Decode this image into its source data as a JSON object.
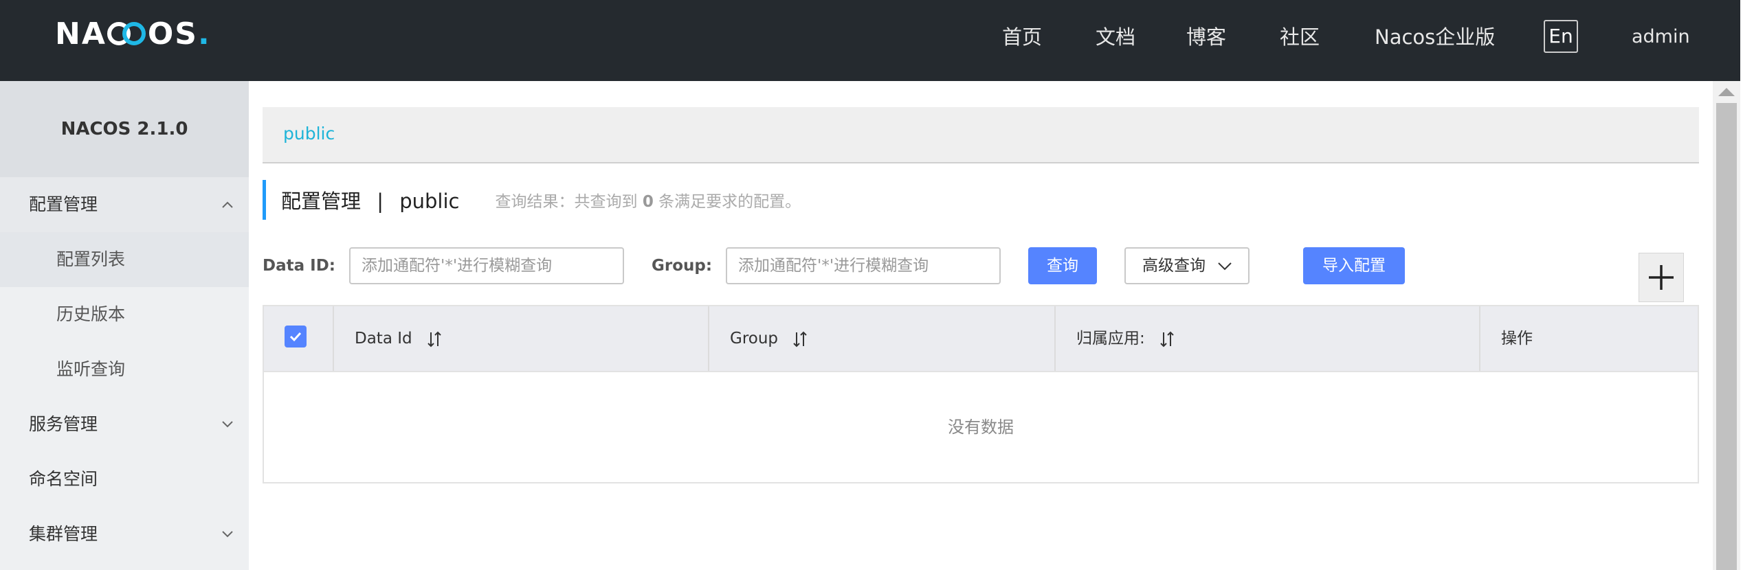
{
  "header": {
    "logo": {
      "prefix": "NA",
      "suffix": "OS",
      "dot": "."
    },
    "nav": [
      "首页",
      "文档",
      "博客",
      "社区",
      "Nacos企业版"
    ],
    "lang": "En",
    "user": "admin"
  },
  "sidebar": {
    "title": "NACOS 2.1.0",
    "items": [
      {
        "label": "配置管理",
        "expanded": true
      },
      {
        "label": "配置列表",
        "sub": true,
        "active": true
      },
      {
        "label": "历史版本",
        "sub": true
      },
      {
        "label": "监听查询",
        "sub": true
      },
      {
        "label": "服务管理",
        "expanded": false
      },
      {
        "label": "命名空间"
      },
      {
        "label": "集群管理",
        "expanded": false
      }
    ]
  },
  "main": {
    "namespace": "public",
    "title": "配置管理",
    "title_sep": "|",
    "title_ns": "public",
    "result": {
      "prefix": "查询结果：共查询到",
      "count": "0",
      "suffix": "条满足要求的配置。"
    },
    "filters": {
      "dataid_label": "Data ID:",
      "dataid_placeholder": "添加通配符'*'进行模糊查询",
      "group_label": "Group:",
      "group_placeholder": "添加通配符'*'进行模糊查询",
      "query_btn": "查询",
      "advanced_btn": "高级查询",
      "import_btn": "导入配置"
    },
    "table": {
      "columns": [
        "Data Id",
        "Group",
        "归属应用:",
        "操作"
      ],
      "empty_text": "没有数据"
    }
  },
  "colors": {
    "header_bg": "#252a2f",
    "accent": "#5584ff",
    "link": "#1fb4d8",
    "sidebar_bg": "#eef0f2"
  }
}
